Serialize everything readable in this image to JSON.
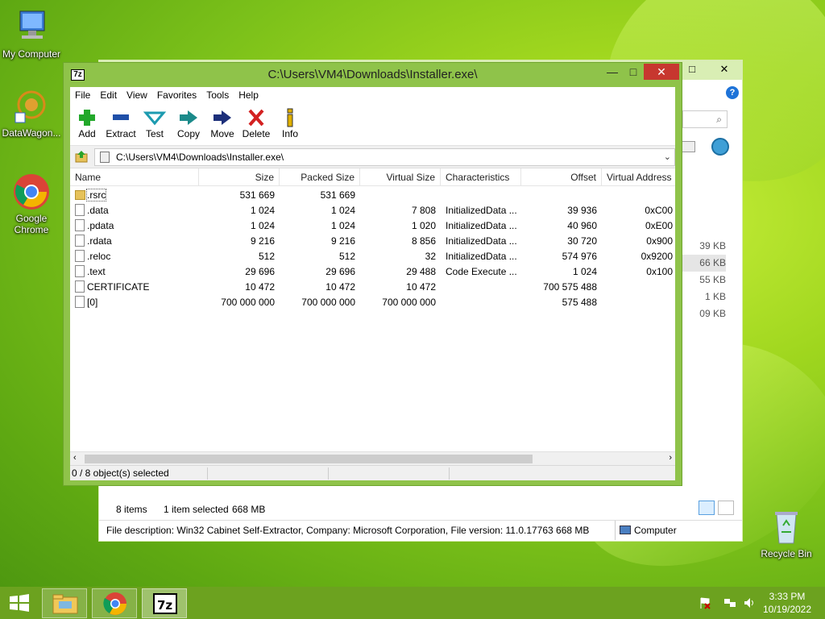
{
  "desktop": {
    "icons": [
      {
        "label": "My Computer"
      },
      {
        "label": "DataWagon..."
      },
      {
        "label": "Google Chrome"
      },
      {
        "label": "Recycle Bin"
      }
    ]
  },
  "explorer": {
    "size_fragments": [
      "39 KB",
      "66 KB",
      "55 KB",
      "1 KB",
      "09 KB"
    ],
    "items_count": "8 items",
    "selected": "1 item selected",
    "selected_size": "668 MB",
    "file_description": "File description: Win32 Cabinet Self-Extractor, Company: Microsoft Corporation, File version: 11.0.17763 668 MB",
    "location": "Computer"
  },
  "sevenzip": {
    "app_icon_text": "7z",
    "title": "C:\\Users\\VM4\\Downloads\\Installer.exe\\",
    "menu": [
      "File",
      "Edit",
      "View",
      "Favorites",
      "Tools",
      "Help"
    ],
    "toolbar": [
      {
        "label": "Add",
        "icon": "plus-icon"
      },
      {
        "label": "Extract",
        "icon": "minus-icon"
      },
      {
        "label": "Test",
        "icon": "check-icon"
      },
      {
        "label": "Copy",
        "icon": "copy-arrow-icon"
      },
      {
        "label": "Move",
        "icon": "move-arrow-icon"
      },
      {
        "label": "Delete",
        "icon": "delete-x-icon"
      },
      {
        "label": "Info",
        "icon": "info-icon"
      }
    ],
    "address": "C:\\Users\\VM4\\Downloads\\Installer.exe\\",
    "columns": [
      "Name",
      "Size",
      "Packed Size",
      "Virtual Size",
      "Characteristics",
      "Offset",
      "Virtual Address"
    ],
    "rows": [
      {
        "name": ".rsrc",
        "size": "531 669",
        "packed": "531 669",
        "vsize": "",
        "chars": "",
        "offset": "",
        "vaddr": "",
        "folder": true
      },
      {
        "name": ".data",
        "size": "1 024",
        "packed": "1 024",
        "vsize": "7 808",
        "chars": "InitializedData ...",
        "offset": "39 936",
        "vaddr": "0xC00",
        "folder": false
      },
      {
        "name": ".pdata",
        "size": "1 024",
        "packed": "1 024",
        "vsize": "1 020",
        "chars": "InitializedData ...",
        "offset": "40 960",
        "vaddr": "0xE00",
        "folder": false
      },
      {
        "name": ".rdata",
        "size": "9 216",
        "packed": "9 216",
        "vsize": "8 856",
        "chars": "InitializedData ...",
        "offset": "30 720",
        "vaddr": "0x900",
        "folder": false
      },
      {
        "name": ".reloc",
        "size": "512",
        "packed": "512",
        "vsize": "32",
        "chars": "InitializedData ...",
        "offset": "574 976",
        "vaddr": "0x9200",
        "folder": false
      },
      {
        "name": ".text",
        "size": "29 696",
        "packed": "29 696",
        "vsize": "29 488",
        "chars": "Code Execute ...",
        "offset": "1 024",
        "vaddr": "0x100",
        "folder": false
      },
      {
        "name": "CERTIFICATE",
        "size": "10 472",
        "packed": "10 472",
        "vsize": "10 472",
        "chars": "",
        "offset": "700 575 488",
        "vaddr": "",
        "folder": false
      },
      {
        "name": "[0]",
        "size": "700 000 000",
        "packed": "700 000 000",
        "vsize": "700 000 000",
        "chars": "",
        "offset": "575 488",
        "vaddr": "",
        "folder": false
      }
    ],
    "status": "0 / 8 object(s) selected"
  },
  "taskbar": {
    "apps": [
      "file-explorer-icon",
      "chrome-icon",
      "7zip-icon"
    ],
    "time": "3:33 PM",
    "date": "10/19/2022"
  },
  "colors": {
    "window_frame": "#8fc34a",
    "taskbar": "#6ca21f",
    "close_button": "#c7372f"
  }
}
